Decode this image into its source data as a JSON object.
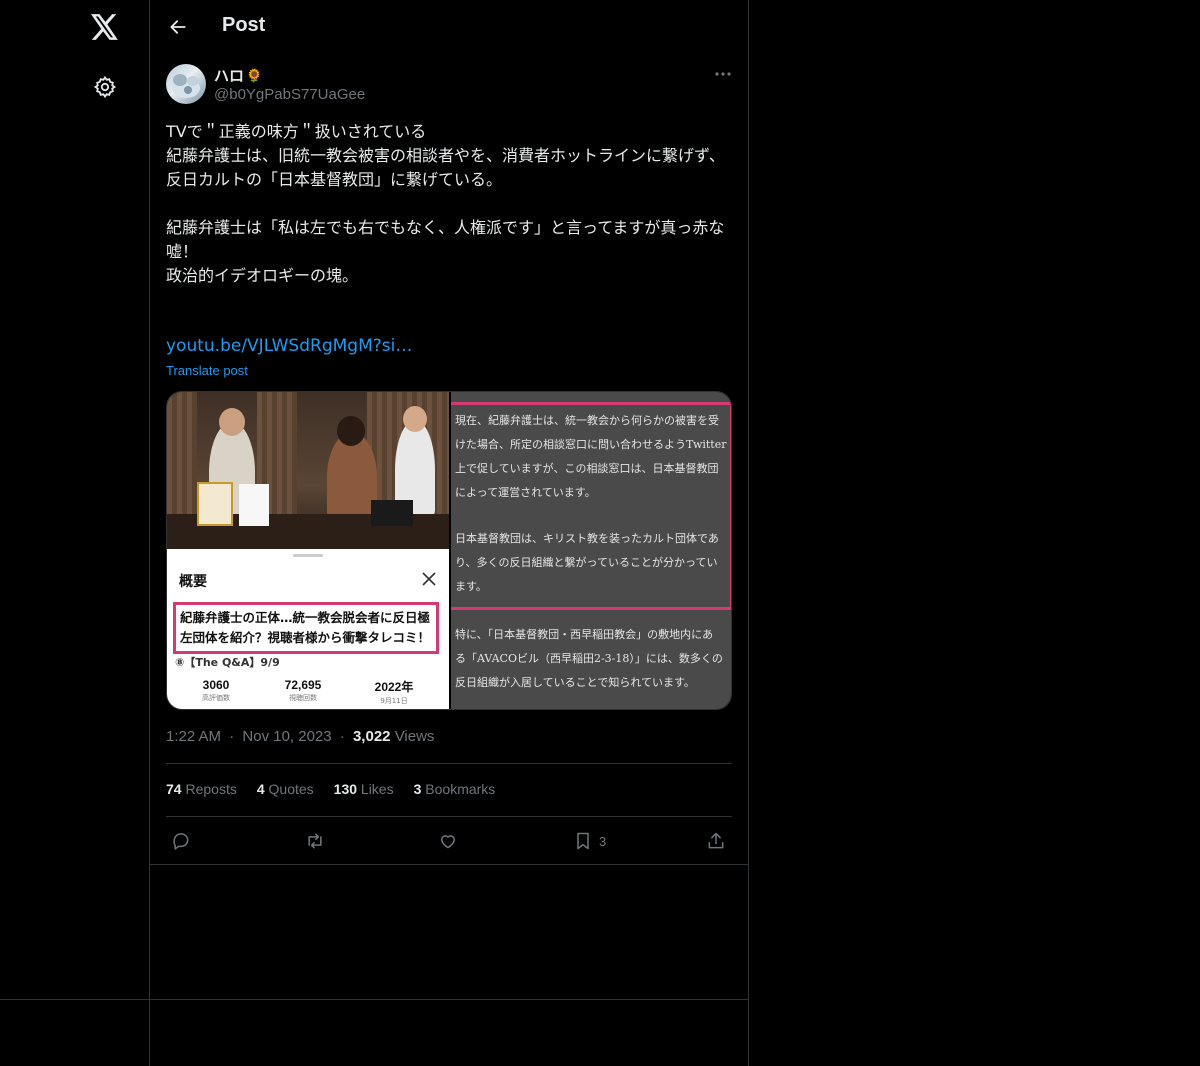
{
  "header": {
    "title": "Post"
  },
  "author": {
    "display_name": "ハロ",
    "name_emoji": "🌻",
    "handle": "@b0YgPabS77UaGee"
  },
  "tweet": {
    "text": "TVで＂正義の味方＂扱いされている\n紀藤弁護士は、旧統一教会被害の相談者やを、消費者ホットラインに繋げず、\n反日カルトの「日本基督教団」に繋げている。\n\n紀藤弁護士は「私は左でも右でもなく、人権派です」と言ってますが真っ赤な嘘！\n政治的イデオロギーの塊。",
    "link_text": "youtu.be/VJLWSdRgMgM?si…",
    "translate_label": "Translate post"
  },
  "media": {
    "summary_title": "概要",
    "summary_headline": "紀藤弁護士の正体…統一教会脱会者に反日極左団体を紹介？視聴者様から衝撃タレコミ！",
    "summary_sub": "⑧【The Q&A】9/9",
    "stats": [
      {
        "value": "3060",
        "label": "高評価数"
      },
      {
        "value": "72,695",
        "label": "視聴回数"
      },
      {
        "value": "2022年",
        "label": "9月11日"
      }
    ],
    "doc_paragraph_1": "現在、紀藤弁護士は、統一教会から何らかの被害を受\nけた場合、所定の相談窓口に問い合わせるようTwitter\n上で促していますが、この相談窓口は、日本基督教団\nによって運営されています。",
    "doc_paragraph_2": "日本基督教団は、キリスト教を装ったカルト団体であ\nり、多くの反日組織と繋がっていることが分かってい\nます。",
    "doc_paragraph_3": "特に、「日本基督教団・西早稲田教会」の敷地内にあ\nる「AVACOビル（西早稲田2-3-18）」には、数多くの\n反日組織が入居していることで知られています。"
  },
  "meta": {
    "time": "1:22 AM",
    "date": "Nov 10, 2023",
    "views_count": "3,022",
    "views_label": "Views",
    "separator": "·"
  },
  "engagement": {
    "reposts_count": "74",
    "reposts_label": "Reposts",
    "quotes_count": "4",
    "quotes_label": "Quotes",
    "likes_count": "130",
    "likes_label": "Likes",
    "bookmarks_count": "3",
    "bookmarks_label": "Bookmarks"
  },
  "actions": {
    "bookmark_count": "3"
  },
  "colors": {
    "background": "#000000",
    "border": "#2f3336",
    "accent": "#1d9bf0",
    "muted": "#71767b",
    "highlight_frame": "#d63a75"
  }
}
